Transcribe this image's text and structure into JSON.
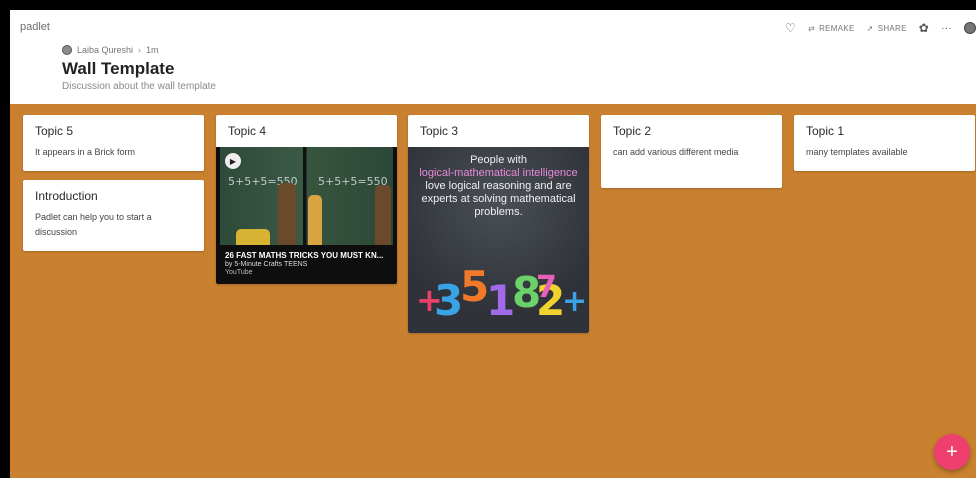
{
  "app": {
    "name": "padlet"
  },
  "header": {
    "author": "Laiba Qureshi",
    "time": "1m",
    "title": "Wall Template",
    "subtitle": "Discussion about the wall template"
  },
  "actions": {
    "remake": "REMAKE",
    "share": "SHARE",
    "more": "···"
  },
  "icons": [
    "heart-icon",
    "remake-icon",
    "share-icon",
    "gear-icon",
    "more-icon",
    "avatar",
    "play-icon",
    "add-icon"
  ],
  "columns": [
    {
      "cards": [
        {
          "title": "Topic 5",
          "body": "It appears in a Brick form"
        },
        {
          "title": "Introduction",
          "body": "Padlet can help you to start a discussion"
        }
      ]
    },
    {
      "cards": [
        {
          "title": "Topic 4",
          "video": {
            "board_text": "5+5+5=550",
            "title": "26 FAST MATHS TRICKS YOU MUST KN...",
            "channel": "by 5-Minute Crafts TEENS",
            "source": "YouTube"
          }
        }
      ]
    },
    {
      "cards": [
        {
          "title": "Topic 3",
          "image": {
            "line1": "People with",
            "highlight": "logical-mathematical intelligence",
            "line2": "love logical reasoning and are experts at solving mathematical problems.",
            "numbers": [
              "+",
              "3",
              "5",
              "1",
              "8",
              "2",
              "7",
              "+"
            ]
          }
        }
      ]
    },
    {
      "cards": [
        {
          "title": "Topic 2",
          "body": "can add various different media"
        }
      ]
    },
    {
      "cards": [
        {
          "title": "Topic 1",
          "body": "many templates available"
        }
      ]
    }
  ],
  "fab": {
    "label": "+"
  },
  "colors": {
    "wall": "#c9802f",
    "fab": "#ee3f6e",
    "highlight": "#e889d9"
  }
}
